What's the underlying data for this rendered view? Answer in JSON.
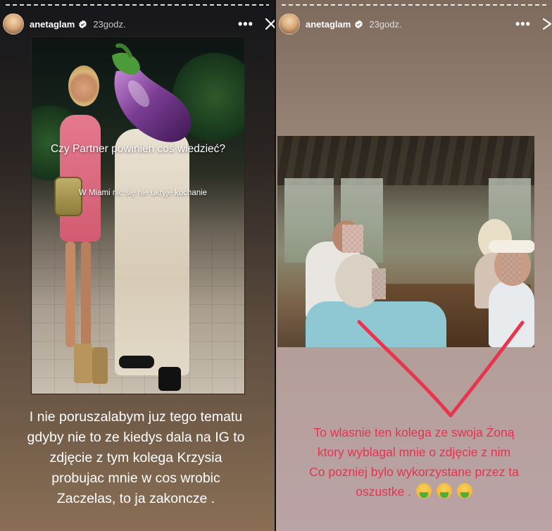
{
  "left_story": {
    "username": "anetaglam",
    "time": "23godz.",
    "more_label": "•••",
    "sticker_question": "Czy Partner powinien coś wiedzieć?",
    "sticker_text": "W Miami nic się nie ukryje kochanie",
    "caption_lines": [
      "I nie poruszalabym juz tego tematu",
      "gdyby nie to ze kiedys dala na IG to",
      "zdjęcie z tym kolega Krzysia",
      "probujac mnie w cos wrobic",
      "Zaczelas, to ja zakoncze ."
    ]
  },
  "right_story": {
    "username": "anetaglam",
    "time": "23godz.",
    "more_label": "•••",
    "caption_lines": [
      "To wlasnie ten kolega ze swoja Żoną",
      "ktory wyblagal mnie o zdjęcie z nim",
      "Co pozniej bylo wykorzystane przez ta",
      "oszustke ."
    ],
    "emoji_count": 3
  },
  "colors": {
    "caption_right": "#e8314f",
    "arrow": "#e8354f",
    "verified": "#ffffff"
  },
  "icons": [
    "avatar",
    "verified-icon",
    "more-icon",
    "close-icon",
    "eggplant-sticker",
    "nauseated-face-emoji"
  ]
}
